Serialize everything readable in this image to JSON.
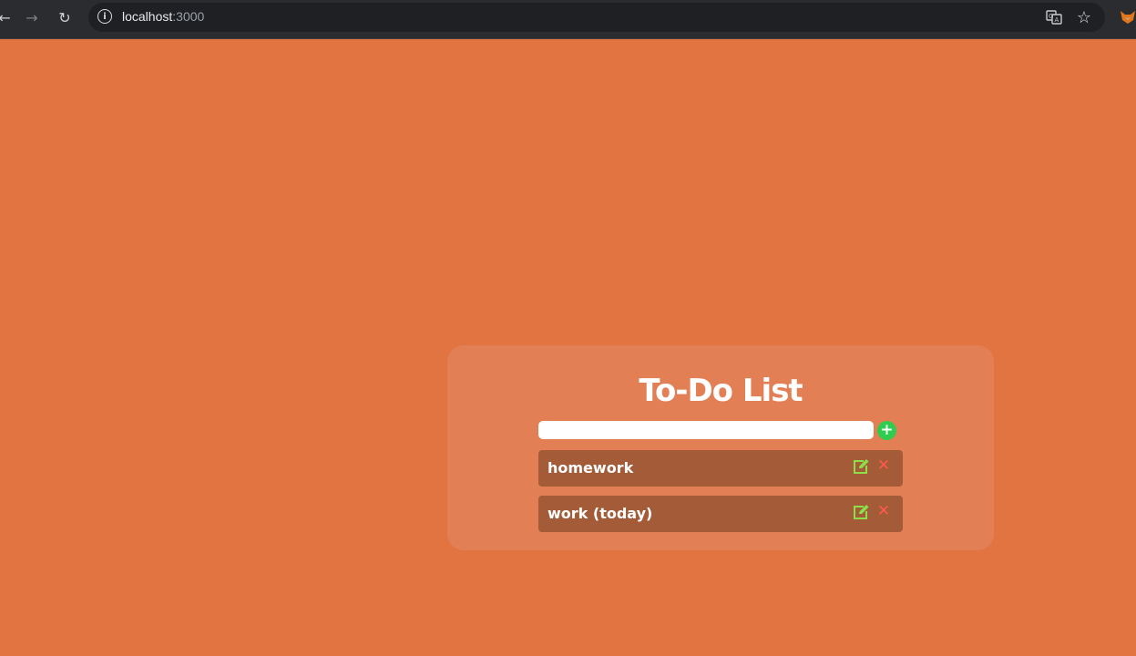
{
  "browser": {
    "back_glyph": "←",
    "forward_glyph": "→",
    "reload_glyph": "↻",
    "info_glyph": "i",
    "url_host": "localhost",
    "url_port": ":3000",
    "star_glyph": "☆"
  },
  "app": {
    "background_color": "#e17441",
    "title": "To-Do List",
    "input": {
      "value": "",
      "placeholder": ""
    },
    "add_glyph": "+",
    "todos": [
      {
        "text": "homework",
        "edit_icon": "edit-icon",
        "delete_glyph": "✕"
      },
      {
        "text": "work (today)",
        "edit_icon": "edit-icon",
        "delete_glyph": "✕"
      }
    ],
    "colors": {
      "card": "#e37f54",
      "item": "#a35b38",
      "add_button": "#2ecc4f",
      "edit_icon": "#8be04a",
      "delete_icon": "#ff5a4f"
    }
  }
}
